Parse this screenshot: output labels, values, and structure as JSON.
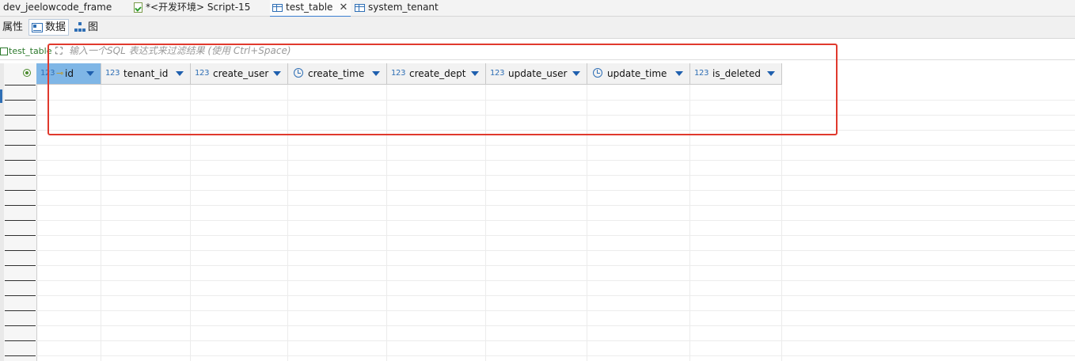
{
  "tabs": [
    {
      "label": "dev_jeelowcode_frame",
      "icon": "none",
      "active": false
    },
    {
      "label": "*<开发环境> Script-15",
      "icon": "sql-script-icon",
      "active": false
    },
    {
      "label": "test_table",
      "icon": "table-icon",
      "active": true,
      "closable": true
    },
    {
      "label": "system_tenant",
      "icon": "table-icon",
      "active": false
    }
  ],
  "close_glyph": "✕",
  "subtabs": {
    "properties": "属性",
    "data": "数据",
    "diagram": "图",
    "active": "data"
  },
  "filter": {
    "table_label": "test_table",
    "placeholder": "输入一个SQL 表达式来过滤结果 (使用 Ctrl+Space)"
  },
  "grid": {
    "columns": [
      {
        "type_label": "123",
        "name": "id",
        "kind": "numeric-key",
        "selected": true
      },
      {
        "type_label": "123",
        "name": "tenant_id",
        "kind": "numeric"
      },
      {
        "type_label": "123",
        "name": "create_user",
        "kind": "numeric"
      },
      {
        "type_label": "",
        "name": "create_time",
        "kind": "datetime"
      },
      {
        "type_label": "123",
        "name": "create_dept",
        "kind": "numeric"
      },
      {
        "type_label": "123",
        "name": "update_user",
        "kind": "numeric"
      },
      {
        "type_label": "",
        "name": "update_time",
        "kind": "datetime"
      },
      {
        "type_label": "123",
        "name": "is_deleted",
        "kind": "numeric"
      }
    ],
    "rows": []
  },
  "colors": {
    "selected_header": "#7fb6e6",
    "annotation": "#e0392d",
    "type_icon": "#2f6fb5"
  }
}
